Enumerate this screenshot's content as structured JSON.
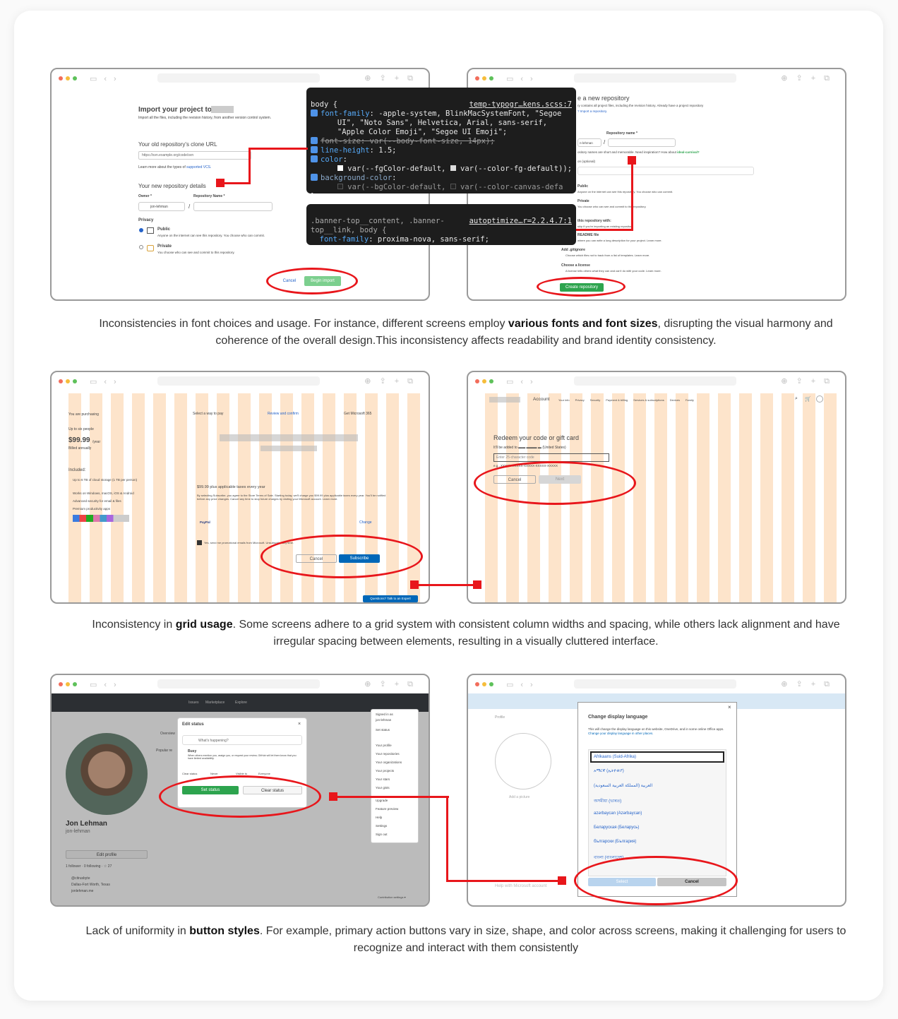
{
  "captions": {
    "fonts": {
      "before": "Inconsistencies in font choices and usage. For instance, different screens employ ",
      "bold": "various fonts and font sizes",
      "after": ", disrupting the visual harmony and coherence of the overall design.This inconsistency affects readability and brand identity consistency."
    },
    "grid": {
      "before": "Inconsistency in ",
      "bold": "grid usage",
      "after": ". Some screens adhere to a grid system with consistent column widths and spacing, while others lack alignment and have irregular spacing between elements, resulting in a visually cluttered interface."
    },
    "buttons": {
      "before": "Lack of uniformity in ",
      "bold": "button styles",
      "after": ". For example, primary action buttons vary in size, shape, and color across screens, making it challenging for users to recognize and interact with them consistently"
    }
  },
  "github_import": {
    "title": "Import your project to",
    "subtitle": "Import all the files, including the revision history, from another version control system.",
    "clone_label": "Your old repository's clone URL",
    "clone_placeholder": "https://svn.example.org/code/svn",
    "learn_more": "Learn more about the types of",
    "supported_vcs": "supported VCS.",
    "new_details": "Your new repository details",
    "owner_label": "Owner *",
    "repo_name_label": "Repository Name *",
    "owner_value": "jon-lehman",
    "privacy": "Privacy",
    "public": "Public",
    "public_desc": "Anyone on the internet can see this repository. You choose who can commit.",
    "private": "Private",
    "private_desc": "You choose who can see and commit to this repository.",
    "cancel": "Cancel",
    "begin_import": "Begin import"
  },
  "devtools": {
    "rule1_selector": "body {",
    "rule1_source": "temp-typogr…kens.scss:7",
    "font_family_prop": "font-family",
    "font_family_value": ": -apple-system, BlinkMacSystemFont, \"Segoe",
    "font_family_line2": "      UI\", \"Noto Sans\", Helvetica, Arial, sans-serif,",
    "font_family_line3": "      \"Apple Color Emoji\", \"Segoe UI Emoji\";",
    "font_size_line": "font-size: var(--body-font-size, 14px);",
    "line_height_prop": "line-height",
    "line_height_value": ": 1.5;",
    "color_prop": "color",
    "color_value": ":",
    "color_var_line": "var(--fgColor-default, ",
    "color_var_line2": "var(--color-fg-default));",
    "bg_prop": "background-color",
    "bg_value": ":",
    "bg_var_line": "var(--bgColor-default, ",
    "bg_var_line2": "var(--color-canvas-defa",
    "close_brace": "}",
    "rule2_selector": ".banner-top__content, .banner-",
    "rule2_selector2": "top__link, body {",
    "rule2_source": "autoptimize…r=2.2.4.7:1",
    "rule2_prop": "font-family",
    "rule2_value": ": proxima-nova, sans-serif;"
  },
  "github_create": {
    "title": "e a new repository",
    "subtitle": "ry contains all project files, including the revision history. Already have a project repository",
    "import_link": "? Import a repository.",
    "repo_name_label": "Repository name *",
    "owner_value": "n-lehman",
    "hint": "ository names are short and memorable. Need inspiration? How about",
    "hint_link": "ideal-carnival?",
    "desc_label": "on (optional)",
    "public": "Public",
    "public_desc": "Anyone on the internet can see this repository. You choose who can commit.",
    "private": "Private",
    "private_desc": "You choose who can see and commit to this repository.",
    "init": "this repository with:",
    "init_desc": "skip if you're importing an existing repository.",
    "readme": "README file",
    "readme_desc": "where you can write a long description for your project. Learn more.",
    "gitignore": "Add .gitignore",
    "gitignore_desc": "Choose which files not to track from a list of templates. Learn more.",
    "license": "Choose a license",
    "license_desc": "A license tells others what they can and can't do with your code. Learn more.",
    "create": "Create repository"
  },
  "ms_checkout": {
    "purchasing": "You are purchasing",
    "up_to": "Up to six people",
    "price": "$99.99",
    "per_year": "/year",
    "billed": "Billed annually",
    "included": "Included:",
    "features": [
      "Up to 6 TB of cloud storage (1 TB per person)",
      "Works on Windows, macOS, iOS & Android",
      "Advanced security for email & files",
      "Premium productivity apps"
    ],
    "step1": "Select a way to pay",
    "step2": "Review and confirm",
    "step3": "Get Microsoft 365",
    "plan_price": "$99.99 plus applicable taxes every year",
    "terms": "By selecting Subscribe, you agree to the Store Terms of Sale. Starting today, we'll charge you $99.99 plus applicable taxes every year. You'll be notified before any price changes. Cancel any time to stop future charges by visiting your Microsoft account. Learn more.",
    "paypal": "PayPal",
    "change": "Change",
    "promo": "Yes, send me promotional emails from Microsoft. Unsubscribe any time.",
    "cancel": "Cancel",
    "subscribe": "Subscribe",
    "expert": "Questions? Talk to an Expert"
  },
  "ms_account": {
    "brand": "Account",
    "nav": [
      "Your info",
      "Privacy",
      "Security",
      "Payment & billing",
      "Services & subscriptions",
      "Devices",
      "Family"
    ],
    "heading": "Redeem your code or gift card",
    "added_to": "It'll be added to",
    "region": "(United States)",
    "placeholder": "Enter 25-character code",
    "example": "e.g., XXXXX-XXXXX-XXXXX-XXXXX-XXXXX",
    "cancel": "Cancel",
    "next": "Next"
  },
  "github_status": {
    "nav": [
      "Issues",
      "Marketplace",
      "Explore"
    ],
    "dialog_title": "Edit status",
    "placeholder": "What's happening?",
    "busy": "Busy",
    "busy_desc": "When others mention you, assign you, or request your review, GitHub will let them know that you have limited availability.",
    "clear_label": "Clear status",
    "never": "Never",
    "visible_to": "Visible to",
    "everyone": "Everyone",
    "set_status": "Set status",
    "clear_status": "Clear status",
    "name": "Jon Lehman",
    "username": "jon-lehman",
    "edit_profile": "Edit profile",
    "followers": "1 follower · 0 following · ☆ 27",
    "org": "@citrusbyte",
    "location": "Dallas-Fort Worth, Texas",
    "site": "jonlehman.me",
    "menu": [
      "Signed in as",
      "jon-lehman",
      "Set status",
      "Your profile",
      "Your repositories",
      "Your organizations",
      "Your projects",
      "Your stars",
      "Your gists",
      "Upgrade",
      "Feature preview",
      "Help",
      "Settings",
      "Sign out"
    ],
    "overview": "Overview",
    "popular": "Popular re",
    "contribution": "Contribution settings ▾"
  },
  "ms_language": {
    "title": "Change display language",
    "desc": "This will change the display language on this website, OneDrive, and in some online Office apps.",
    "desc_link": "Change your display language in other places.",
    "languages": [
      "Afrikaans (Suid-Afrika)",
      "አማርኛ (ኢትዮጵያ)",
      "العربية (المملكة العربية السعودية)",
      "অসমীয়া (ভাৰত)",
      "azərbaycan (Azərbaycan)",
      "Беларуская (Беларусь)",
      "български (България)",
      "বাংলা (বাংলাদেশ)"
    ],
    "select": "Select",
    "cancel": "Cancel",
    "bg_profile": "Profile",
    "bg_add": "Add a picture",
    "bg_help": "Help with Microsoft account"
  },
  "colors": {
    "accent_red": "#e8161b",
    "grid_overlay": "#fccda0",
    "github_green": "#2da44e",
    "ms_blue": "#0067b8"
  },
  "icons": [
    "search-icon",
    "cart-icon",
    "avatar-icon",
    "close-icon",
    "lock-icon",
    "monitor-icon"
  ]
}
